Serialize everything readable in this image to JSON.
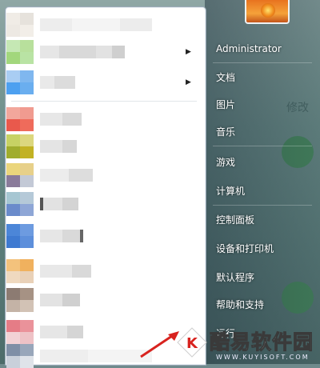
{
  "right_menu": {
    "items": [
      {
        "label": "Administrator",
        "name": "user-name"
      },
      {
        "label": "文档",
        "name": "documents"
      },
      {
        "label": "图片",
        "name": "pictures"
      },
      {
        "label": "音乐",
        "name": "music"
      },
      {
        "label": "游戏",
        "name": "games"
      },
      {
        "label": "计算机",
        "name": "computer"
      },
      {
        "label": "控制面板",
        "name": "control-panel"
      },
      {
        "label": "设备和打印机",
        "name": "devices-printers"
      },
      {
        "label": "默认程序",
        "name": "default-programs"
      },
      {
        "label": "帮助和支持",
        "name": "help-support"
      },
      {
        "label": "运行...",
        "name": "run"
      }
    ]
  },
  "desktop": {
    "text": "修改"
  },
  "watermark": {
    "brand": "酷易软件园",
    "url": "WWW.KUYISOFT.COM"
  },
  "colors": {
    "left_pane_bg": "#ffffff",
    "right_pane_text": "#ffffff",
    "accent_orange": "#e8731f"
  }
}
